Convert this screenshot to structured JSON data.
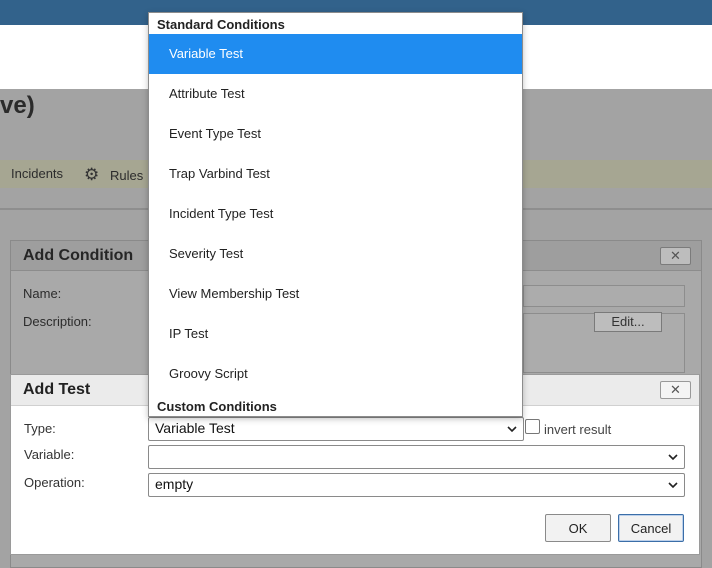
{
  "page": {
    "title_fragment": "ve)"
  },
  "toolbar": {
    "incidents_label": "Incidents",
    "rules_label": "Rules"
  },
  "add_condition": {
    "title": "Add Condition",
    "name_label": "Name:",
    "description_label": "Description:",
    "edit_label": "Edit..."
  },
  "add_test": {
    "title": "Add Test",
    "type_label": "Type:",
    "type_value": "Variable Test",
    "invert_label": "invert result",
    "variable_label": "Variable:",
    "variable_value": "",
    "operation_label": "Operation:",
    "operation_value": "empty",
    "ok_label": "OK",
    "cancel_label": "Cancel"
  },
  "dropdown": {
    "standard_group": "Standard Conditions",
    "custom_group": "Custom Conditions",
    "options": [
      "Variable Test",
      "Attribute Test",
      "Event Type Test",
      "Trap Varbind Test",
      "Incident Type Test",
      "Severity Test",
      "View Membership Test",
      "IP Test",
      "Groovy Script"
    ],
    "selected_index": 0
  },
  "colors": {
    "topbar": "#32628b",
    "selected_option": "#1f8cf0",
    "overlay_gray": "#a3a3a3"
  }
}
